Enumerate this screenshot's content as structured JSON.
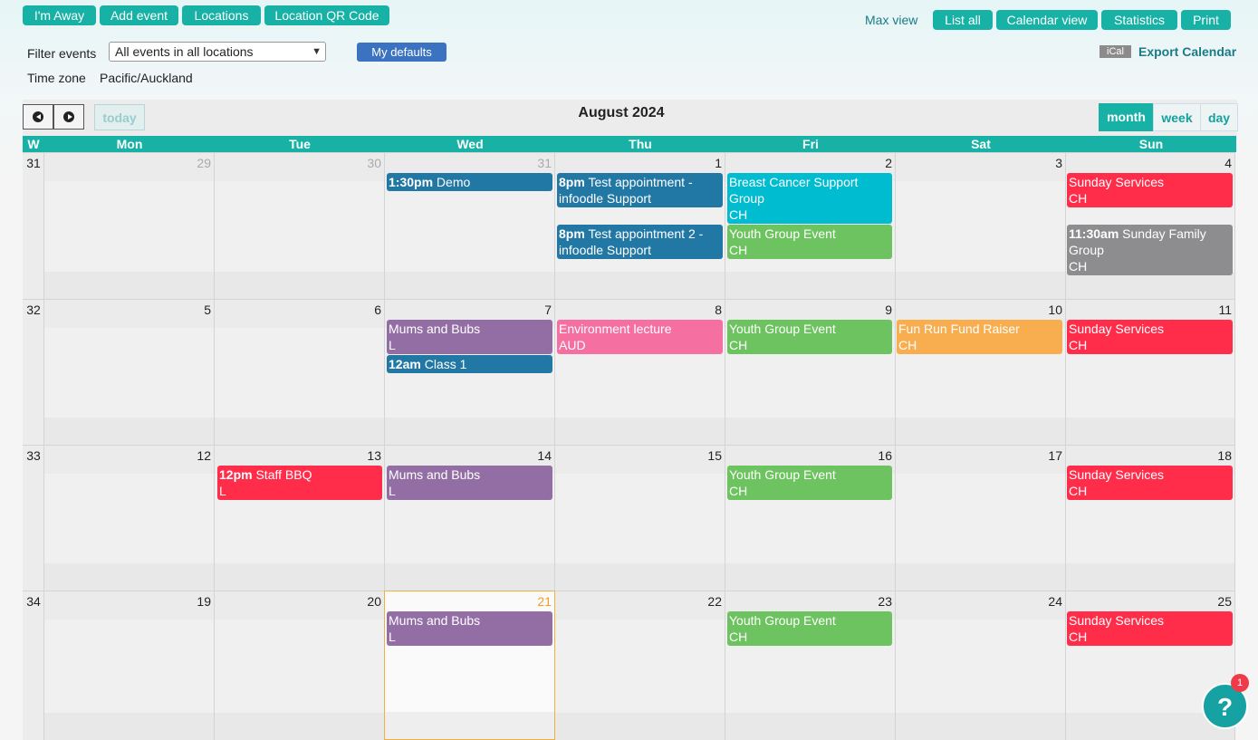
{
  "toolbar": {
    "im_away": "I'm Away",
    "add_event": "Add event",
    "locations": "Locations",
    "location_qr": "Location QR Code",
    "max_view": "Max view",
    "list_all": "List all",
    "calendar_view": "Calendar view",
    "statistics": "Statistics",
    "print": "Print"
  },
  "filter": {
    "label": "Filter events",
    "selected": "All events in all locations",
    "my_defaults": "My defaults"
  },
  "timezone": {
    "label": "Time zone",
    "value": "Pacific/Auckland"
  },
  "export": {
    "ical_badge": "iCal",
    "label": "Export Calendar"
  },
  "calendar": {
    "title": "August 2024",
    "today_label": "today",
    "views": {
      "month": "month",
      "week": "week",
      "day": "day"
    },
    "weekday_headers": [
      "W",
      "Mon",
      "Tue",
      "Wed",
      "Thu",
      "Fri",
      "Sat",
      "Sun"
    ],
    "weeks": [
      {
        "number": "31",
        "days": [
          "29",
          "30",
          "31",
          "1",
          "2",
          "3",
          "4"
        ]
      },
      {
        "number": "32",
        "days": [
          "5",
          "6",
          "7",
          "8",
          "9",
          "10",
          "11"
        ]
      },
      {
        "number": "33",
        "days": [
          "12",
          "13",
          "14",
          "15",
          "16",
          "17",
          "18"
        ]
      },
      {
        "number": "34",
        "days": [
          "19",
          "20",
          "21",
          "22",
          "23",
          "24",
          "25"
        ]
      }
    ],
    "events": {
      "w0_wed_1": {
        "time": "1:30pm",
        "title": "Demo"
      },
      "w0_thu_1": {
        "time": "8pm",
        "title": "Test appointment - infoodle Support"
      },
      "w0_thu_2": {
        "time": "8pm",
        "title": "Test appointment 2 - infoodle Support"
      },
      "w0_fri_1": {
        "title": "Breast Cancer Support Group",
        "loc": "CH"
      },
      "w0_fri_2": {
        "title": "Youth Group Event",
        "loc": "CH"
      },
      "w0_sun_1": {
        "title": "Sunday Services",
        "loc": "CH"
      },
      "w0_sun_2": {
        "time": "11:30am",
        "title": "Sunday Family Group",
        "loc": "CH"
      },
      "w1_wed_1": {
        "title": "Mums and Bubs",
        "loc": "L"
      },
      "w1_wed_2": {
        "time": "12am",
        "title": "Class 1"
      },
      "w1_thu_1": {
        "title": "Environment lecture",
        "loc": "AUD"
      },
      "w1_fri_1": {
        "title": "Youth Group Event",
        "loc": "CH"
      },
      "w1_sat_1": {
        "title": "Fun Run Fund Raiser",
        "loc": "CH"
      },
      "w1_sun_1": {
        "title": "Sunday Services",
        "loc": "CH"
      },
      "w2_tue_1": {
        "time": "12pm",
        "title": "Staff BBQ",
        "loc": "L"
      },
      "w2_wed_1": {
        "title": "Mums and Bubs",
        "loc": "L"
      },
      "w2_fri_1": {
        "title": "Youth Group Event",
        "loc": "CH"
      },
      "w2_sun_1": {
        "title": "Sunday Services",
        "loc": "CH"
      },
      "w3_wed_1": {
        "title": "Mums and Bubs",
        "loc": "L"
      },
      "w3_fri_1": {
        "title": "Youth Group Event",
        "loc": "CH"
      },
      "w3_sun_1": {
        "title": "Sunday Services",
        "loc": "CH"
      }
    }
  },
  "colors": {
    "accent": "#17b1a6",
    "event_blue": "#2278a4",
    "event_cyan": "#00bcd0",
    "event_green": "#6dc35f",
    "event_red": "#ff2d4a",
    "event_gray": "#8d8d8f",
    "event_purple": "#936ea5",
    "event_pink": "#f56fa0",
    "event_orange": "#f8ae4f"
  },
  "help": {
    "badge_count": "1",
    "icon": "?"
  }
}
